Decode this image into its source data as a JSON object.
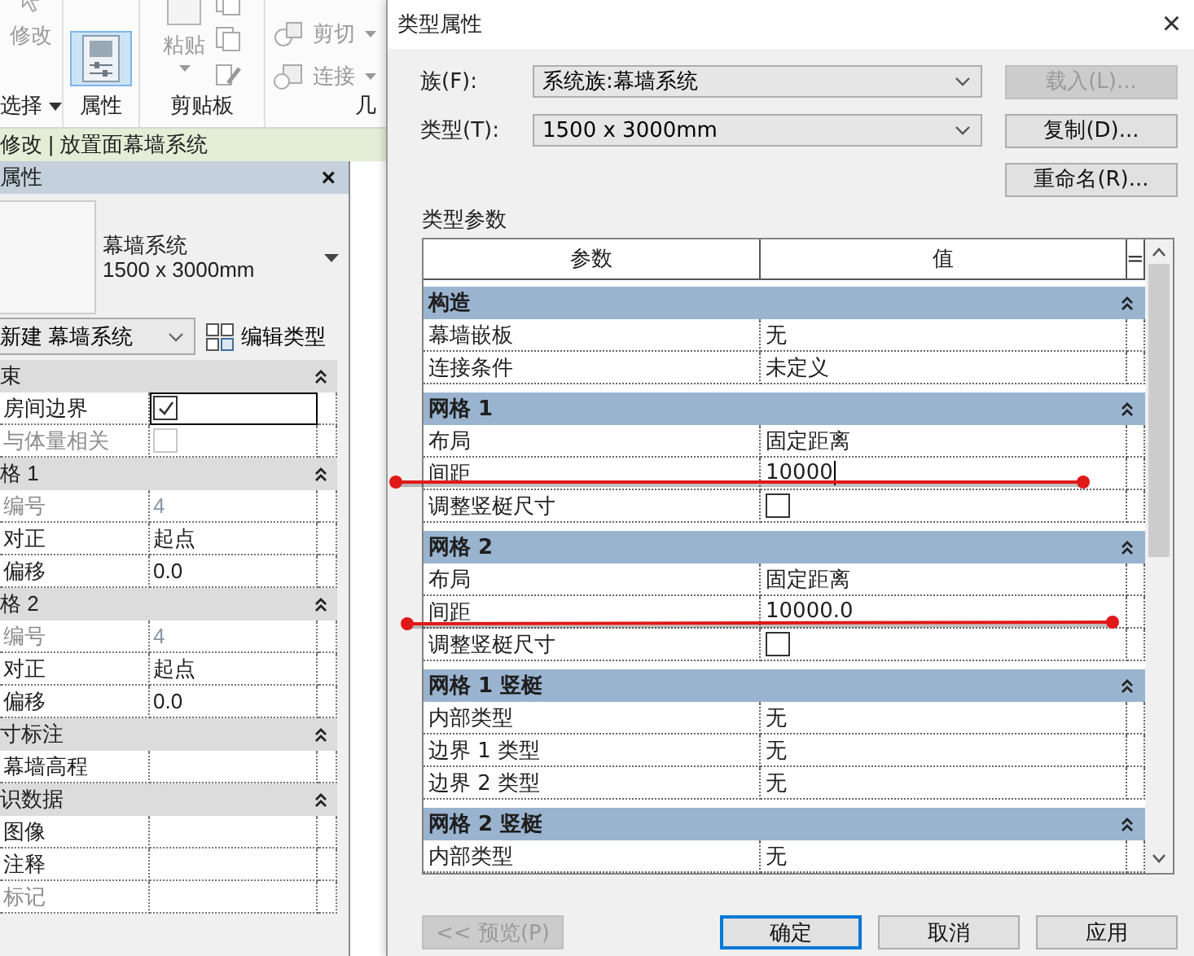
{
  "ribbon": {
    "panels": [
      {
        "label": "选择",
        "menu": true,
        "tools": [
          {
            "kind": "large",
            "label": "修改",
            "disabled": true,
            "menu": false
          }
        ]
      },
      {
        "label": "属性",
        "menu": false,
        "tools": [
          {
            "kind": "toggle",
            "on": true
          }
        ]
      },
      {
        "label": "剪贴板",
        "menu": false,
        "tools": [
          {
            "kind": "large",
            "label": "粘贴",
            "disabled": true,
            "menu": true
          },
          {
            "kind": "stack"
          }
        ]
      },
      {
        "label": "几",
        "menu": false,
        "tools": [
          {
            "kind": "small",
            "label": "剪切",
            "disabled": true,
            "menu": true
          },
          {
            "kind": "small",
            "label": "连接",
            "disabled": true,
            "menu": true
          }
        ]
      }
    ]
  },
  "context_bar": {
    "text": "修改 | 放置面幕墙系统"
  },
  "properties": {
    "title": "属性",
    "close": "×",
    "type_selector": {
      "family": "幕墙系统",
      "type": "1500 x 3000mm"
    },
    "instance_filter": "新建 幕墙系统",
    "edit_type": "编辑类型",
    "groups": [
      {
        "name": "束",
        "expanded": true,
        "rows": [
          {
            "kind": "checkbox",
            "label": "房间边界",
            "checked": true,
            "disabled": false,
            "focused": true
          },
          {
            "kind": "checkbox",
            "label": "与体量相关",
            "checked": false,
            "disabled": true,
            "focused": false
          }
        ]
      },
      {
        "name": "格 1",
        "expanded": true,
        "rows": [
          {
            "kind": "text",
            "label": "编号",
            "value": "4",
            "disabled": true,
            "focused": false
          },
          {
            "kind": "text",
            "label": "对正",
            "value": "起点",
            "disabled": false,
            "focused": false
          },
          {
            "kind": "text",
            "label": "偏移",
            "value": "0.0",
            "disabled": false,
            "focused": false
          }
        ]
      },
      {
        "name": "格 2",
        "expanded": true,
        "rows": [
          {
            "kind": "text",
            "label": "编号",
            "value": "4",
            "disabled": true,
            "focused": false
          },
          {
            "kind": "text",
            "label": "对正",
            "value": "起点",
            "disabled": false,
            "focused": false
          },
          {
            "kind": "text",
            "label": "偏移",
            "value": "0.0",
            "disabled": false,
            "focused": false
          }
        ]
      },
      {
        "name": "寸标注",
        "expanded": true,
        "rows": [
          {
            "kind": "text",
            "label": "幕墙高程",
            "disabled": false,
            "focused": false
          }
        ]
      },
      {
        "name": "识数据",
        "expanded": true,
        "rows": [
          {
            "kind": "text",
            "label": "图像",
            "disabled": false,
            "focused": false
          },
          {
            "kind": "text",
            "label": "注释",
            "disabled": false,
            "focused": false
          },
          {
            "kind": "text",
            "label": "标记",
            "disabled": true,
            "focused": false
          }
        ]
      }
    ]
  },
  "dialog": {
    "title": "类型属性",
    "close": "×",
    "fields": [
      {
        "label": "族(F):",
        "value": "系统族:幕墙系统"
      },
      {
        "label": "类型(T):",
        "value": "1500 x 3000mm"
      }
    ],
    "side_buttons": [
      {
        "label": "载入(L)...",
        "disabled": true
      },
      {
        "label": "复制(D)...",
        "disabled": false
      },
      {
        "label": "重命名(R)...",
        "disabled": false
      }
    ],
    "section_label": "类型参数",
    "columns": [
      "参数",
      "值",
      "="
    ],
    "groups": [
      {
        "name": "构造",
        "expanded": true,
        "rows": [
          {
            "kind": "text",
            "label": "幕墙嵌板",
            "value": "无",
            "editing": false
          },
          {
            "kind": "text",
            "label": "连接条件",
            "value": "未定义",
            "editing": false
          }
        ]
      },
      {
        "name": "网格 1",
        "expanded": true,
        "rows": [
          {
            "kind": "text",
            "label": "布局",
            "value": "固定距离",
            "editing": false
          },
          {
            "kind": "text",
            "label": "间距",
            "value": "10000",
            "editing": true
          },
          {
            "kind": "checkbox",
            "label": "调整竖梃尺寸",
            "checked": false
          }
        ]
      },
      {
        "name": "网格 2",
        "expanded": true,
        "rows": [
          {
            "kind": "text",
            "label": "布局",
            "value": "固定距离",
            "editing": false
          },
          {
            "kind": "text",
            "label": "间距",
            "value": "10000.0",
            "editing": false
          },
          {
            "kind": "checkbox",
            "label": "调整竖梃尺寸",
            "checked": false
          }
        ]
      },
      {
        "name": "网格 1 竖梃",
        "expanded": true,
        "rows": [
          {
            "kind": "text",
            "label": "内部类型",
            "value": "无",
            "editing": false
          },
          {
            "kind": "text",
            "label": "边界 1 类型",
            "value": "无",
            "editing": false
          },
          {
            "kind": "text",
            "label": "边界 2 类型",
            "value": "无",
            "editing": false
          }
        ]
      },
      {
        "name": "网格 2 竖梃",
        "expanded": true,
        "rows": [
          {
            "kind": "text",
            "label": "内部类型",
            "value": "无",
            "editing": false
          }
        ]
      }
    ],
    "footer_buttons": [
      {
        "kind": "preview",
        "label": "<< 预览(P)",
        "disabled": true,
        "default": false
      },
      {
        "kind": "action",
        "label": "确定",
        "disabled": false,
        "default": true
      },
      {
        "kind": "action",
        "label": "取消",
        "disabled": false,
        "default": false
      },
      {
        "kind": "action",
        "label": "应用",
        "disabled": false,
        "default": false
      }
    ]
  }
}
